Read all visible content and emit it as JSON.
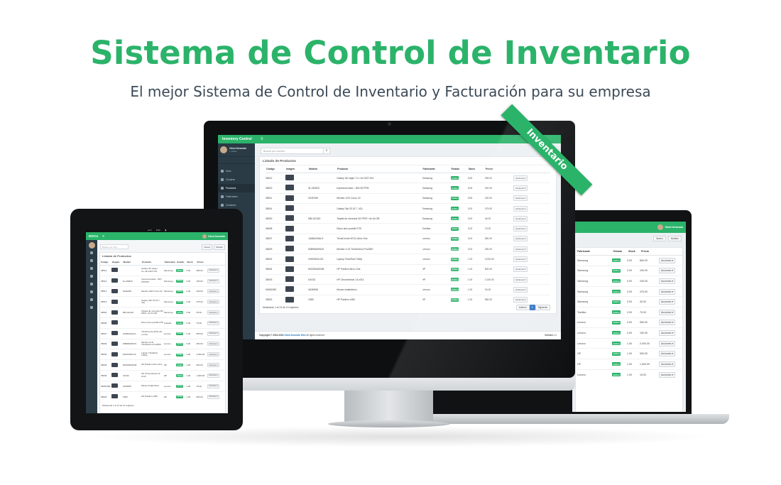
{
  "hero": {
    "title": "Sistema de Control de Inventario",
    "subtitle": "El mejor Sistema de Control de Inventario y Facturación para su empresa"
  },
  "ribbon": "Inventario",
  "colors": {
    "accent": "#2bb36a",
    "sidebar": "#2a3b46",
    "title_text": "#3c4a57"
  },
  "desktop": {
    "brand": "Inventory Control",
    "user": {
      "name": "Obed Alvarado",
      "status": "Online"
    },
    "sidebar": [
      {
        "label": "Inicio",
        "icon": "home-icon"
      },
      {
        "label": "Compras",
        "icon": "cart-icon"
      },
      {
        "label": "Productos",
        "icon": "box-icon",
        "active": true
      },
      {
        "label": "Fabricantes",
        "icon": "factory-icon"
      },
      {
        "label": "Contactos",
        "icon": "users-icon"
      },
      {
        "label": "Facturación",
        "icon": "invoice-icon"
      }
    ],
    "search": {
      "placeholder": "Buscar por nombre"
    },
    "panel_title": "Listado de Productos",
    "columns": [
      "Código",
      "Imagen",
      "Modelo",
      "Producto",
      "Fabricante",
      "Estado",
      "Stock",
      "Precio",
      ""
    ],
    "rows": [
      {
        "code": "38512",
        "model": "",
        "product": "Galaxy S6 edge+ G.L.M-C32T-GN",
        "maker": "Samsung",
        "status": "Activo",
        "stock": "3.00",
        "price": "395.00"
      },
      {
        "code": "38513",
        "model": "SL-M2820",
        "product": "Impresora láser - B/N 28 PPM",
        "maker": "Samsung",
        "status": "Activo",
        "stock": "3.00",
        "price": "150.00"
      },
      {
        "code": "38511",
        "model": "S22E390",
        "product": "Monitor LED Curvo 22",
        "maker": "Samsung",
        "status": "Activo",
        "stock": "3.00",
        "price": "230.00"
      },
      {
        "code": "38514",
        "model": "",
        "product": "Galaxy Tab S2 (9.7, 4G)",
        "maker": "Samsung",
        "status": "Activo",
        "stock": "3.00",
        "price": "475.00"
      },
      {
        "code": "38000",
        "model": "MB-32GAD",
        "product": "Tarjeta de memoria SD PRO+ de 64 GB",
        "maker": "Samsung",
        "status": "Activo",
        "stock": "3.00",
        "price": "45.00"
      },
      {
        "code": "38008",
        "model": "",
        "product": "Disco duro portátil 1TB",
        "maker": "Toshiba",
        "status": "Activo",
        "stock": "3.00",
        "price": "75.00"
      },
      {
        "code": "38007",
        "model": "10ABA0HALS",
        "product": "ThinkCentre M72z All-in-One",
        "maker": "Lenovo",
        "status": "Activo",
        "stock": "3.00",
        "price": "550.00"
      },
      {
        "code": "38009",
        "model": "60B9MAR6US",
        "product": "Monitor LCD ThinkVision Pro2820",
        "maker": "Lenovo",
        "status": "Activo",
        "stock": "3.00",
        "price": "250.00"
      },
      {
        "code": "38002",
        "model": "20HNS00LUS",
        "product": "Laptop ThinkPad T460p",
        "maker": "Lenovo",
        "status": "Activo",
        "stock": "1.00",
        "price": "2,000.00"
      },
      {
        "code": "38004",
        "model": "M0ZD84ARAB",
        "product": "HP Pavilion All-in-One",
        "maker": "HP",
        "status": "Activo",
        "stock": "1.00",
        "price": "500.00"
      },
      {
        "code": "38003",
        "model": "K4X32",
        "product": "HP Chromebook 14-x013",
        "maker": "HP",
        "status": "Activo",
        "stock": "1.00",
        "price": "1,000.00"
      },
      {
        "code": "06081380",
        "model": "0A36508",
        "product": "Mouse inalámbrico",
        "maker": "Lenovo",
        "status": "Activo",
        "stock": "1.00",
        "price": "15.00"
      },
      {
        "code": "38002",
        "model": "X380",
        "product": "HP Pavilion x360",
        "maker": "HP",
        "status": "Activo",
        "stock": "1.00",
        "price": "550.00"
      }
    ],
    "actions_label": "Acciones",
    "footer_count": "Mostrando 1 al 13 de 13 registros",
    "pagination": {
      "prev": "Anterior",
      "page": "1",
      "next": "Siguiente"
    },
    "copyright_text": "Copyright © 2015-2016",
    "copyright_brand": "Obed Alvarado Web",
    "copyright_suffix": "All rights reserved.",
    "version_label": "Versión",
    "version": "1.0"
  },
  "laptop": {
    "user": "Obed Alvarado",
    "buttons": {
      "new": "Nuevo",
      "filter": "Modelo"
    },
    "columns": [
      "Fabricante",
      "Estado",
      "Stock",
      "Precio",
      ""
    ],
    "rows": [
      {
        "maker": "Samsung",
        "status": "Activo",
        "stock": "3.00",
        "price": "850.00"
      },
      {
        "maker": "Samsung",
        "status": "Activo",
        "stock": "3.00",
        "price": "150.00"
      },
      {
        "maker": "Samsung",
        "status": "Activo",
        "stock": "3.00",
        "price": "230.00"
      },
      {
        "maker": "Samsung",
        "status": "Activo",
        "stock": "3.00",
        "price": "475.00"
      },
      {
        "maker": "Samsung",
        "status": "Activo",
        "stock": "3.00",
        "price": "45.00"
      },
      {
        "maker": "Toshiba",
        "status": "Activo",
        "stock": "3.00",
        "price": "75.00"
      },
      {
        "maker": "Lenovo",
        "status": "Activo",
        "stock": "4.00",
        "price": "550.00"
      },
      {
        "maker": "Lenovo",
        "status": "Activo",
        "stock": "4.00",
        "price": "150.00"
      },
      {
        "maker": "Lenovo",
        "status": "Activo",
        "stock": "1.00",
        "price": "2,000.00"
      },
      {
        "maker": "HP",
        "status": "Activo",
        "stock": "1.00",
        "price": "500.00"
      },
      {
        "maker": "HP",
        "status": "Activo",
        "stock": "1.00",
        "price": "1,000.00"
      },
      {
        "maker": "Lenovo",
        "status": "Activo",
        "stock": "1.00",
        "price": "15.00"
      }
    ],
    "actions_label": "Acciones"
  },
  "tablet": {
    "brand": "INVCo",
    "user": "Obed Alvarado",
    "search": {
      "placeholder": "Buscar por nom"
    },
    "buttons": {
      "new": "Nuevo",
      "filter": "Modelo"
    },
    "panel_title": "Listado de Productos",
    "columns": [
      "Código",
      "Imagen",
      "Modelo",
      "Producto",
      "Fabricante",
      "Estado",
      "Stock",
      "Precio",
      ""
    ],
    "rows": [
      {
        "code": "38512",
        "model": "",
        "product": "Galaxy S6 edge+ G.L.M-C32T-GN",
        "maker": "Samsung",
        "stock": "3.00",
        "price": "395.00"
      },
      {
        "code": "38513",
        "model": "SL-M2820",
        "product": "Impresora láser - B/N 28 PPM",
        "maker": "Samsung",
        "stock": "3.00",
        "price": "150.00"
      },
      {
        "code": "38511",
        "model": "S22E390",
        "product": "Monitor LED Curvo 22",
        "maker": "Samsung",
        "stock": "3.00",
        "price": "230.00"
      },
      {
        "code": "38514",
        "model": "",
        "product": "Galaxy Tab S2 (9.7, 4G)",
        "maker": "Samsung",
        "stock": "3.00",
        "price": "475.00"
      },
      {
        "code": "38000",
        "model": "MB-32GAD",
        "product": "Tarjeta de memoria SD PRO+ de 64 GB",
        "maker": "Samsung",
        "stock": "3.00",
        "price": "45.00"
      },
      {
        "code": "38008",
        "model": "",
        "product": "Disco duro portátil 1TB",
        "maker": "Toshiba",
        "stock": "3.00",
        "price": "75.00"
      },
      {
        "code": "38007",
        "model": "10ABA0HALS",
        "product": "ThinkCentre M72z All-in-One",
        "maker": "Lenovo",
        "stock": "3.00",
        "price": "550.00"
      },
      {
        "code": "38009",
        "model": "60B9MAR6US",
        "product": "Monitor LCD ThinkVision Pro2820",
        "maker": "Lenovo",
        "stock": "3.00",
        "price": "250.00"
      },
      {
        "code": "38002",
        "model": "20HNS00LUS",
        "product": "Laptop ThinkPad T460p",
        "maker": "Lenovo",
        "stock": "1.00",
        "price": "2,000.00"
      },
      {
        "code": "38004",
        "model": "M0ZD84ARAB",
        "product": "HP Pavilion All-in-One",
        "maker": "HP",
        "stock": "1.00",
        "price": "500.00"
      },
      {
        "code": "38003",
        "model": "K4X32",
        "product": "HP Chromebook 14-x013",
        "maker": "HP",
        "stock": "1.00",
        "price": "1,000.00"
      },
      {
        "code": "06081380",
        "model": "0A36508",
        "product": "Mouse inalámbrico",
        "maker": "Lenovo",
        "stock": "1.00",
        "price": "15.00"
      },
      {
        "code": "38002",
        "model": "X380",
        "product": "HP Pavilion x360",
        "maker": "HP",
        "stock": "1.00",
        "price": "550.00"
      }
    ],
    "status_label": "Activo",
    "actions_label": "Acciones",
    "footer_count": "Mostrando 1 al 13 de 13 registros"
  }
}
